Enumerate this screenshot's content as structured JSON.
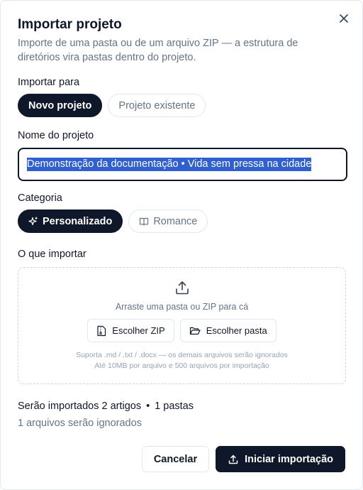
{
  "dialog": {
    "title": "Importar projeto",
    "subtitle": "Importe de uma pasta ou de um arquivo ZIP — a estrutura de diretórios vira pastas dentro do projeto.",
    "close_icon": "close-icon"
  },
  "import_to": {
    "label": "Importar para",
    "options": [
      "Novo projeto",
      "Projeto existente"
    ],
    "selected": "Novo projeto"
  },
  "project_name": {
    "label": "Nome do projeto",
    "value": "Demonstração da documentação  •  Vida sem pressa na cidade"
  },
  "category": {
    "label": "Categoria",
    "options": [
      {
        "label": "Personalizado",
        "icon": "sparkles-icon"
      },
      {
        "label": "Romance",
        "icon": "book-open-icon"
      }
    ],
    "selected": "Personalizado"
  },
  "what_to_import": {
    "label": "O que importar",
    "drop_hint": "Arraste uma pasta ou ZIP para cá",
    "choose_zip": "Escolher ZIP",
    "choose_folder": "Escolher pasta",
    "supported": "Suporta .md / .txt / .docx — os demais arquivos serão ignorados",
    "limits": "Até 10MB por arquivo e 500 arquivos por importação"
  },
  "summary": {
    "articles": "Serão importados 2 artigos",
    "separator": "•",
    "folders": "1 pastas",
    "ignored": "1 arquivos serão ignorados"
  },
  "footer": {
    "cancel": "Cancelar",
    "start": "Iniciar importação"
  },
  "colors": {
    "primary": "#0f172a",
    "muted": "#64748b",
    "selection": "#2f5fd0",
    "border": "#e2e8f0"
  }
}
